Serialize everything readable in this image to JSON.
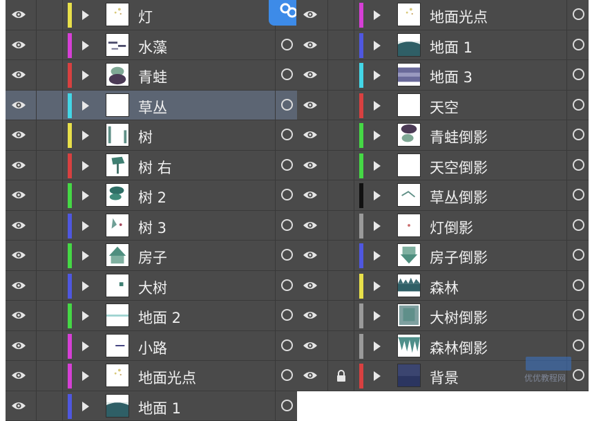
{
  "colors": {
    "yellow": "#e8e04a",
    "magenta": "#d63fd6",
    "red": "#d84040",
    "cyan": "#43d6e6",
    "green": "#45d845",
    "blue": "#4f57e0",
    "black": "#111111",
    "gray": "#9a9a9a"
  },
  "left_layers": [
    {
      "name": "灯",
      "color": "#e8e04a",
      "thumb": "lamp"
    },
    {
      "name": "水藻",
      "color": "#d63fd6",
      "thumb": "algae"
    },
    {
      "name": "青蛙",
      "color": "#d84040",
      "thumb": "frog"
    },
    {
      "name": "草丛",
      "color": "#43d6e6",
      "thumb": "blank",
      "selected": true
    },
    {
      "name": "树",
      "color": "#e8e04a",
      "thumb": "tree"
    },
    {
      "name": "树 右",
      "color": "#d84040",
      "thumb": "tree-right"
    },
    {
      "name": "树 2",
      "color": "#45d845",
      "thumb": "tree2"
    },
    {
      "name": "树 3",
      "color": "#4f57e0",
      "thumb": "tree3"
    },
    {
      "name": "房子",
      "color": "#45d845",
      "thumb": "house"
    },
    {
      "name": "大树",
      "color": "#4f57e0",
      "thumb": "bigtree"
    },
    {
      "name": "地面 2",
      "color": "#45d845",
      "thumb": "ground2"
    },
    {
      "name": "小路",
      "color": "#d63fd6",
      "thumb": "path"
    },
    {
      "name": "地面光点",
      "color": "#d63fd6",
      "thumb": "lamp"
    },
    {
      "name": "地面 1",
      "color": "#4f57e0",
      "thumb": "ground1"
    }
  ],
  "right_layers": [
    {
      "name": "地面光点",
      "color": "#d63fd6",
      "thumb": "lamp"
    },
    {
      "name": "地面 1",
      "color": "#4f57e0",
      "thumb": "ground1"
    },
    {
      "name": "地面 3",
      "color": "#43d6e6",
      "thumb": "ground3"
    },
    {
      "name": "天空",
      "color": "#d84040",
      "thumb": "blank"
    },
    {
      "name": "青蛙倒影",
      "color": "#45d845",
      "thumb": "frogrefl"
    },
    {
      "name": "天空倒影",
      "color": "#45d845",
      "thumb": "blank"
    },
    {
      "name": "草丛倒影",
      "color": "#111111",
      "thumb": "grassrefl"
    },
    {
      "name": "灯倒影",
      "color": "#9a9a9a",
      "thumb": "lamprefl"
    },
    {
      "name": "房子倒影",
      "color": "#4f57e0",
      "thumb": "houserefl"
    },
    {
      "name": "森林",
      "color": "#e8e04a",
      "thumb": "forest"
    },
    {
      "name": "大树倒影",
      "color": "#9a9a9a",
      "thumb": "bigtreerefl"
    },
    {
      "name": "森林倒影",
      "color": "#9a9a9a",
      "thumb": "forestrefl"
    },
    {
      "name": "背景",
      "color": "#d84040",
      "thumb": "bg",
      "locked": true
    }
  ],
  "icons": {
    "visibility": "eye-icon",
    "expand": "disclosure-triangle-icon",
    "target": "target-circle-icon",
    "lock": "lock-icon",
    "link": "link-icon"
  },
  "watermark": {
    "text": "优优教程网"
  }
}
